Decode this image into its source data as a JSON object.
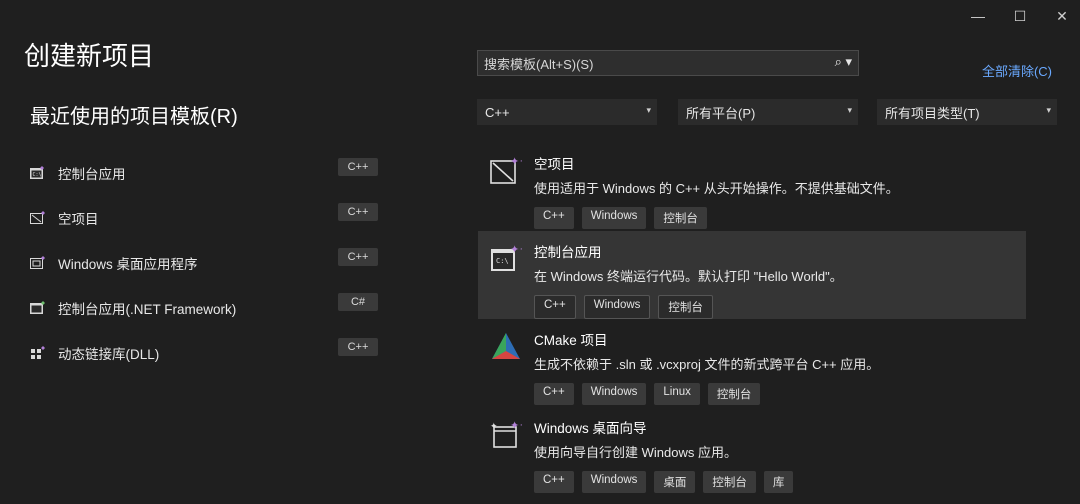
{
  "window": {
    "minimize": "—",
    "maximize": "☐",
    "close": "✕"
  },
  "title": "创建新项目",
  "recent": {
    "heading": "最近使用的项目模板(R)",
    "items": [
      {
        "label": "控制台应用",
        "lang": "C++",
        "icon": "console-app-icon"
      },
      {
        "label": "空项目",
        "lang": "C++",
        "icon": "empty-project-icon"
      },
      {
        "label": "Windows 桌面应用程序",
        "lang": "C++",
        "icon": "desktop-app-icon"
      },
      {
        "label": "控制台应用(.NET Framework)",
        "lang": "C#",
        "icon": "console-app-cs-icon"
      },
      {
        "label": "动态链接库(DLL)",
        "lang": "C++",
        "icon": "dll-icon"
      }
    ]
  },
  "search": {
    "placeholder": "搜索模板(Alt+S)(S)",
    "icon": "search-icon"
  },
  "clear_all": "全部清除(C)",
  "filters": {
    "language": "C++",
    "platform": "所有平台(P)",
    "project_type": "所有项目类型(T)"
  },
  "templates": [
    {
      "title": "空项目",
      "desc": "使用适用于 Windows 的 C++ 从头开始操作。不提供基础文件。",
      "tags": [
        "C++",
        "Windows",
        "控制台"
      ],
      "icon": "empty-project-icon"
    },
    {
      "title": "控制台应用",
      "desc": "在 Windows 终端运行代码。默认打印 \"Hello World\"。",
      "tags": [
        "C++",
        "Windows",
        "控制台"
      ],
      "icon": "console-app-icon"
    },
    {
      "title": "CMake 项目",
      "desc": "生成不依赖于 .sln 或 .vcxproj 文件的新式跨平台 C++ 应用。",
      "tags": [
        "C++",
        "Windows",
        "Linux",
        "控制台"
      ],
      "icon": "cmake-icon"
    },
    {
      "title": "Windows 桌面向导",
      "desc": "使用向导自行创建 Windows 应用。",
      "tags": [
        "C++",
        "Windows",
        "桌面",
        "控制台",
        "库"
      ],
      "icon": "desktop-wizard-icon"
    }
  ],
  "colors": {
    "background": "#1f1f1f",
    "selected": "#353535",
    "link": "#6aa9ff",
    "accent_purple": "#b180d7"
  }
}
